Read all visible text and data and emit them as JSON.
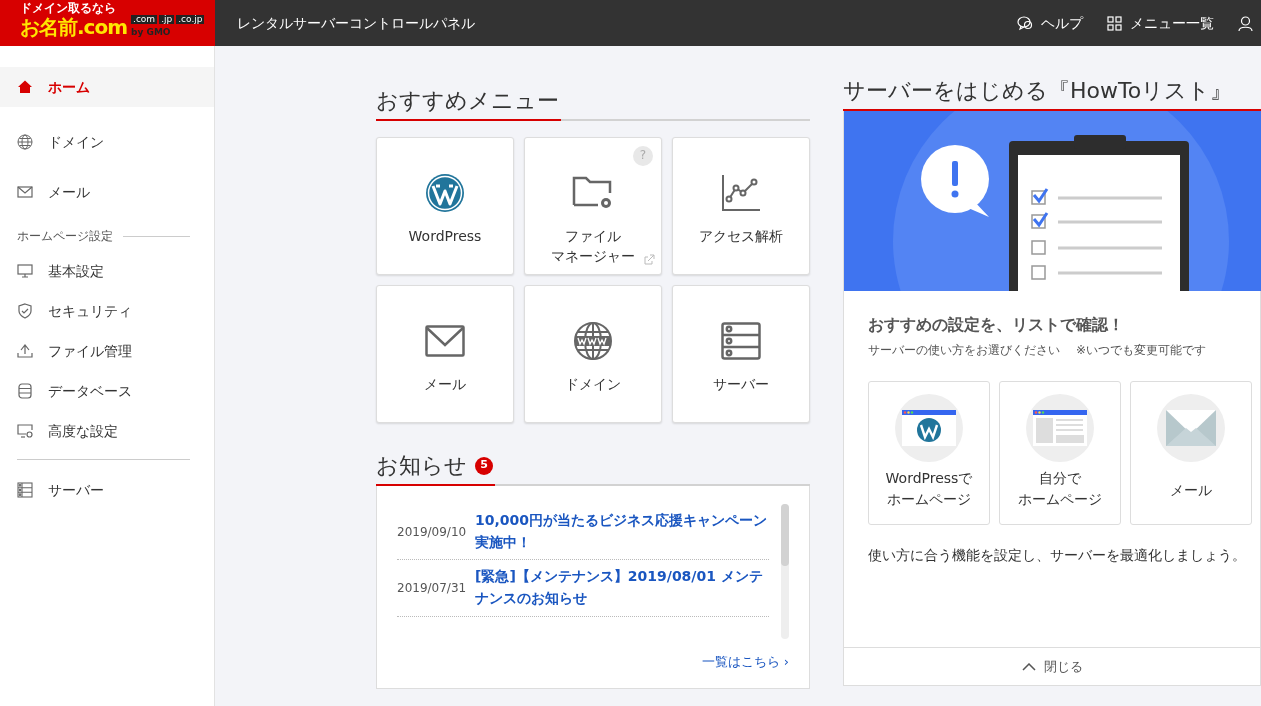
{
  "header": {
    "logo": {
      "tagline": "ドメイン取るなら",
      "name": "お名前.com",
      "domains": [
        ".com",
        ".jp",
        ".co.jp"
      ],
      "by": "by GMO"
    },
    "title": "レンタルサーバーコントロールパネル",
    "actions": [
      {
        "label": "ヘルプ",
        "kind": "help"
      },
      {
        "label": "メニュー一覧",
        "kind": "grid"
      }
    ]
  },
  "sidebar": {
    "groups": [
      {
        "items": [
          {
            "label": "ホーム",
            "kind": "home",
            "selected": true
          },
          {
            "label": "ドメイン",
            "kind": "globe",
            "selected": false
          },
          {
            "label": "メール",
            "kind": "mail",
            "selected": false
          }
        ]
      },
      {
        "heading": "ホームページ設定",
        "items": [
          {
            "label": "基本設定",
            "kind": "monitor",
            "selected": false
          },
          {
            "label": "セキュリティ",
            "kind": "shield",
            "selected": false
          },
          {
            "label": "ファイル管理",
            "kind": "upload",
            "selected": false
          },
          {
            "label": "データベース",
            "kind": "database",
            "selected": false
          },
          {
            "label": "高度な設定",
            "kind": "monitor-gear",
            "selected": false
          }
        ]
      },
      {
        "items": [
          {
            "label": "サーバー",
            "kind": "server",
            "selected": false
          }
        ]
      }
    ]
  },
  "recommended": {
    "title": "おすすめメニュー",
    "tiles": [
      {
        "lines": [
          "WordPress"
        ],
        "kind": "wordpress",
        "external": false
      },
      {
        "lines": [
          "ファイル",
          "マネージャー"
        ],
        "kind": "folder",
        "help_mark": "?",
        "external": true
      },
      {
        "lines": [
          "アクセス解析"
        ],
        "kind": "chart",
        "external": false
      },
      {
        "lines": [
          "メール"
        ],
        "kind": "mail",
        "external": false
      },
      {
        "lines": [
          "ドメイン"
        ],
        "kind": "globe",
        "external": false
      },
      {
        "lines": [
          "サーバー"
        ],
        "kind": "server",
        "external": false
      }
    ]
  },
  "news": {
    "title": "お知らせ",
    "count": "5",
    "items": [
      {
        "date": "2019/09/10",
        "title": "10,000円が当たるビジネス応援キャンペーン実施中！"
      },
      {
        "date": "2019/07/31",
        "title": "[緊急]【メンテナンス】2019/08/01 メンテナンスのお知らせ"
      }
    ],
    "more_link": "一覧はこちら ›"
  },
  "howto": {
    "title": "サーバーをはじめる『HowToリスト』",
    "heading": "おすすめの設定を、リストで確認！",
    "subtitle": "サーバーの使い方をお選びください",
    "note": "※いつでも変更可能です",
    "options": [
      {
        "lines": [
          "WordPressで",
          "ホームページ"
        ],
        "kind": "wordpress"
      },
      {
        "lines": [
          "自分で",
          "ホームページ"
        ],
        "kind": "site"
      },
      {
        "lines": [
          "メール"
        ],
        "kind": "mail"
      }
    ],
    "description": "使い方に合う機能を設定し、サーバーを最適化しましょう。",
    "close": "閉じる"
  }
}
